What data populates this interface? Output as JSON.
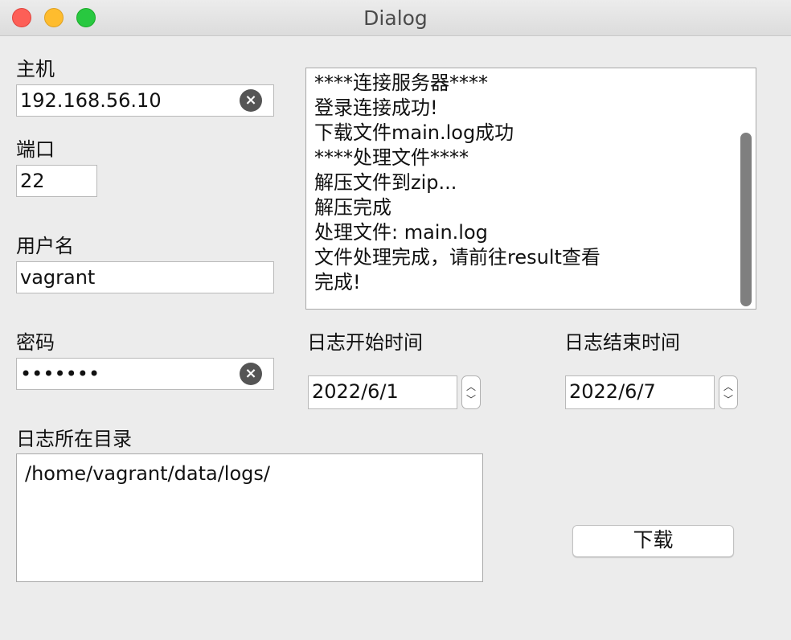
{
  "window": {
    "title": "Dialog"
  },
  "host": {
    "label": "主机",
    "value": "192.168.56.10"
  },
  "port": {
    "label": "端口",
    "value": "22"
  },
  "username": {
    "label": "用户名",
    "value": "vagrant"
  },
  "password": {
    "label": "密码",
    "masked": "•••••••"
  },
  "log_output": {
    "lines": [
      "****连接服务器****",
      "登录连接成功!",
      "下载文件main.log成功",
      "****处理文件****",
      "解压文件到zip...",
      "解压完成",
      "处理文件: main.log",
      "文件处理完成，请前往result查看",
      "完成!"
    ]
  },
  "start_date": {
    "label": "日志开始时间",
    "value": "2022/6/1"
  },
  "end_date": {
    "label": "日志结束时间",
    "value": "2022/6/7"
  },
  "log_dir": {
    "label": "日志所在目录",
    "value": "/home/vagrant/data/logs/"
  },
  "download_button": {
    "label": "下载"
  },
  "icons": {
    "clear": "clear-icon",
    "spin_up": "chevron-up-icon",
    "spin_down": "chevron-down-icon"
  },
  "colors": {
    "close": "#fd5f57",
    "minimize": "#febc2e",
    "maximize": "#28c840",
    "background": "#ececec"
  }
}
